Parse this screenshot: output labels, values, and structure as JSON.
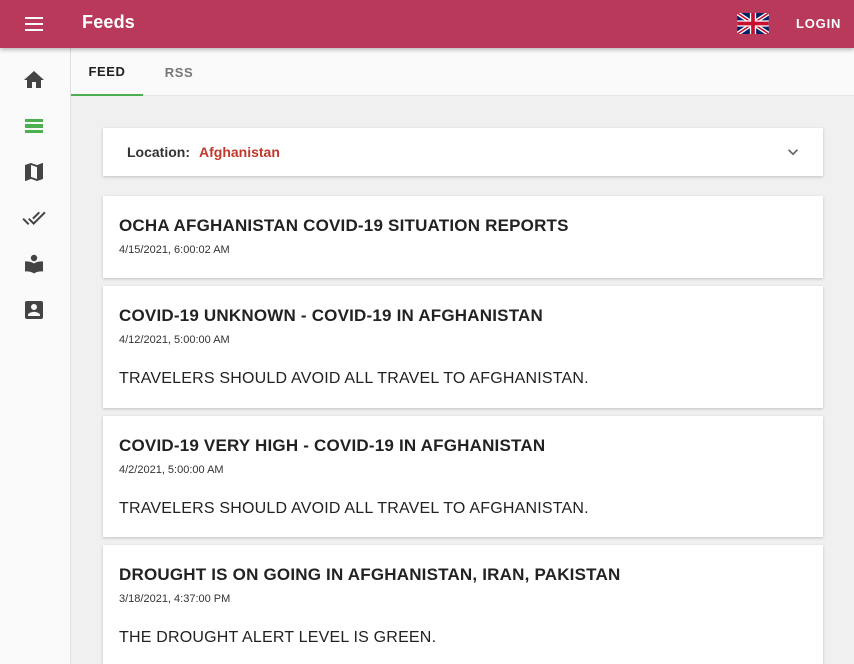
{
  "header": {
    "title": "Feeds",
    "login_label": "LOGIN",
    "menu_icon": "menu-icon",
    "language_flag": "uk-flag-icon",
    "bar_color": "#b8395a"
  },
  "sidebar": {
    "items": [
      {
        "name": "home",
        "icon": "home-icon"
      },
      {
        "name": "feeds",
        "icon": "feed-icon",
        "active": true,
        "active_color": "#4caf50"
      },
      {
        "name": "map",
        "icon": "map-icon"
      },
      {
        "name": "checklist",
        "icon": "done-all-icon"
      },
      {
        "name": "guide",
        "icon": "book-reader-icon"
      },
      {
        "name": "contacts",
        "icon": "contact-icon"
      }
    ]
  },
  "tabs": [
    {
      "label": "FEED",
      "active": true
    },
    {
      "label": "RSS",
      "active": false
    }
  ],
  "location": {
    "label": "Location:",
    "value": "Afghanistan",
    "value_color": "#c0392b"
  },
  "feed_items": [
    {
      "title": "OCHA AFGHANISTAN COVID-19 SITUATION REPORTS",
      "date": "4/15/2021, 6:00:02 AM",
      "description": ""
    },
    {
      "title": "COVID-19 UNKNOWN - COVID-19 IN AFGHANISTAN",
      "date": "4/12/2021, 5:00:00 AM",
      "description": "TRAVELERS SHOULD AVOID ALL TRAVEL TO AFGHANISTAN."
    },
    {
      "title": "COVID-19 VERY HIGH - COVID-19 IN AFGHANISTAN",
      "date": "4/2/2021, 5:00:00 AM",
      "description": "TRAVELERS SHOULD AVOID ALL TRAVEL TO AFGHANISTAN."
    },
    {
      "title": "DROUGHT IS ON GOING IN AFGHANISTAN, IRAN, PAKISTAN",
      "date": "3/18/2021, 4:37:00 PM",
      "description": "THE DROUGHT ALERT LEVEL IS GREEN."
    }
  ]
}
